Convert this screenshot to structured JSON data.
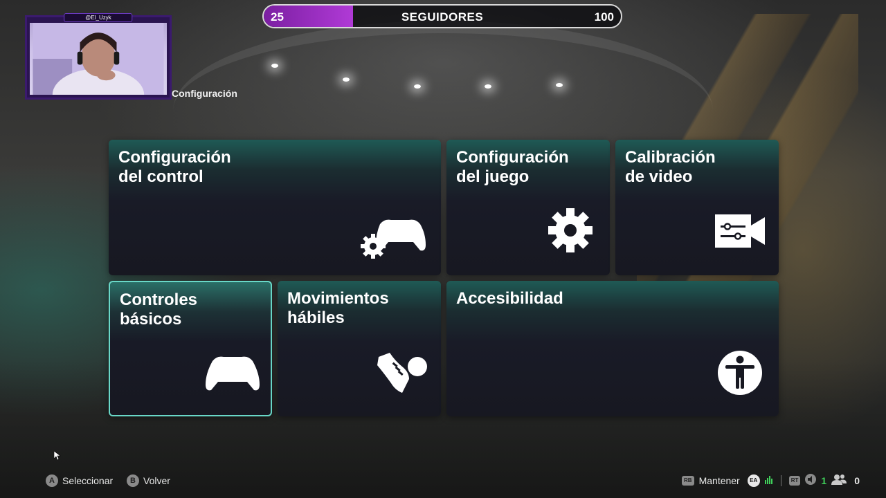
{
  "stream_overlay": {
    "handle": "@El_Uzyk"
  },
  "followers": {
    "current": "25",
    "label": "SEGUIDORES",
    "goal": "100",
    "progress_fraction": 0.25,
    "fill_color": "#9b2fc4"
  },
  "breadcrumb": "Configuración",
  "tiles": [
    {
      "title": "Configuración\ndel control",
      "icon": "controller-gear-icon"
    },
    {
      "title": "Configuración\ndel juego",
      "icon": "gear-icon"
    },
    {
      "title": "Calibración\nde video",
      "icon": "video-settings-icon"
    },
    {
      "title": "Controles\nbásicos",
      "icon": "gamepad-icon",
      "selected": true
    },
    {
      "title": "Movimientos\nhábiles",
      "icon": "boot-ball-icon"
    },
    {
      "title": "Accesibilidad",
      "icon": "accessibility-icon"
    }
  ],
  "footer": {
    "select": {
      "glyph": "A",
      "label": "Seleccionar"
    },
    "back": {
      "glyph": "B",
      "label": "Volver"
    },
    "hold": {
      "glyph": "RB",
      "label": "Mantener"
    },
    "ea_glyph": "EA",
    "rt_glyph": "RT",
    "status_count": "1",
    "friends_count": "0"
  },
  "colors": {
    "accent_teal": "#69d8c8",
    "status_green": "#3fcf5a",
    "followers_purple": "#9b2fc4"
  }
}
